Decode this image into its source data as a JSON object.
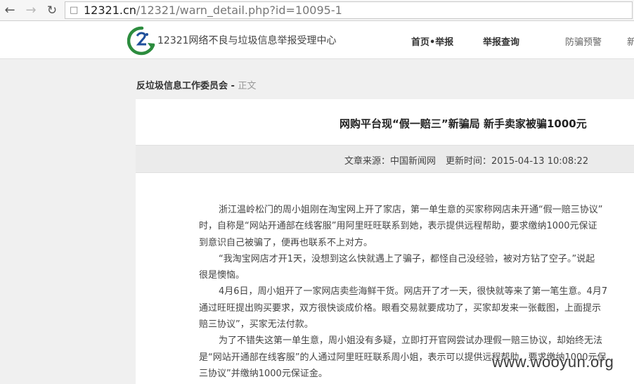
{
  "browser": {
    "url_host": "12321.cn",
    "url_path": "/12321/warn_detail.php?id=10095-1"
  },
  "site": {
    "name": "12321网络不良与垃圾信息举报受理中心",
    "menu": [
      "首页•举报",
      "举报查询",
      "防骗预警",
      "新"
    ]
  },
  "breadcrumb": {
    "parent": "反垃圾信息工作委员会",
    "separator": " - ",
    "current": "正文"
  },
  "article": {
    "title": "网购平台现“假一赔三”新骗局 新手卖家被骗1000元",
    "source_label": "文章来源：中国新闻网",
    "updated_label": "更新时间：2015-04-13 10:08:22",
    "lines": [
      "浙江温岭松门的周小姐刚在淘宝网上开了家店，第一单生意的买家称网店未开通“假一赔三协议”",
      "时，自称是“网站开通部在线客服”用阿里旺旺联系到她，表示提供远程帮助，要求缴纳1000元保证",
      "到意识自己被骗了，便再也联系不上对方。",
      "“我淘宝网店才开1天，没想到这么快就遇上了骗子，都怪自己没经验，被对方钻了空子。”说起",
      "很是懊恼。",
      "4月6日，周小姐开了一家网店卖些海鲜干货。网店开了才一天，很快就等来了第一笔生意。4月7",
      "通过旺旺提出购买要求，双方很快谈成价格。眼看交易就要成功了，买家却发来一张截图，上面提示",
      "赔三协议”，买家无法付款。",
      "为了不错失这第一单生意，周小姐没有多疑，立即打开官网尝试办理假一赔三协议，却始终无法",
      "是“网站开通部在线客服”的人通过阿里旺旺联系周小姐，表示可以提供远程帮助，要求缴纳1000元保",
      "三协议”并缴纳1000元保证金。"
    ]
  },
  "watermark": "www.wooyun.org"
}
